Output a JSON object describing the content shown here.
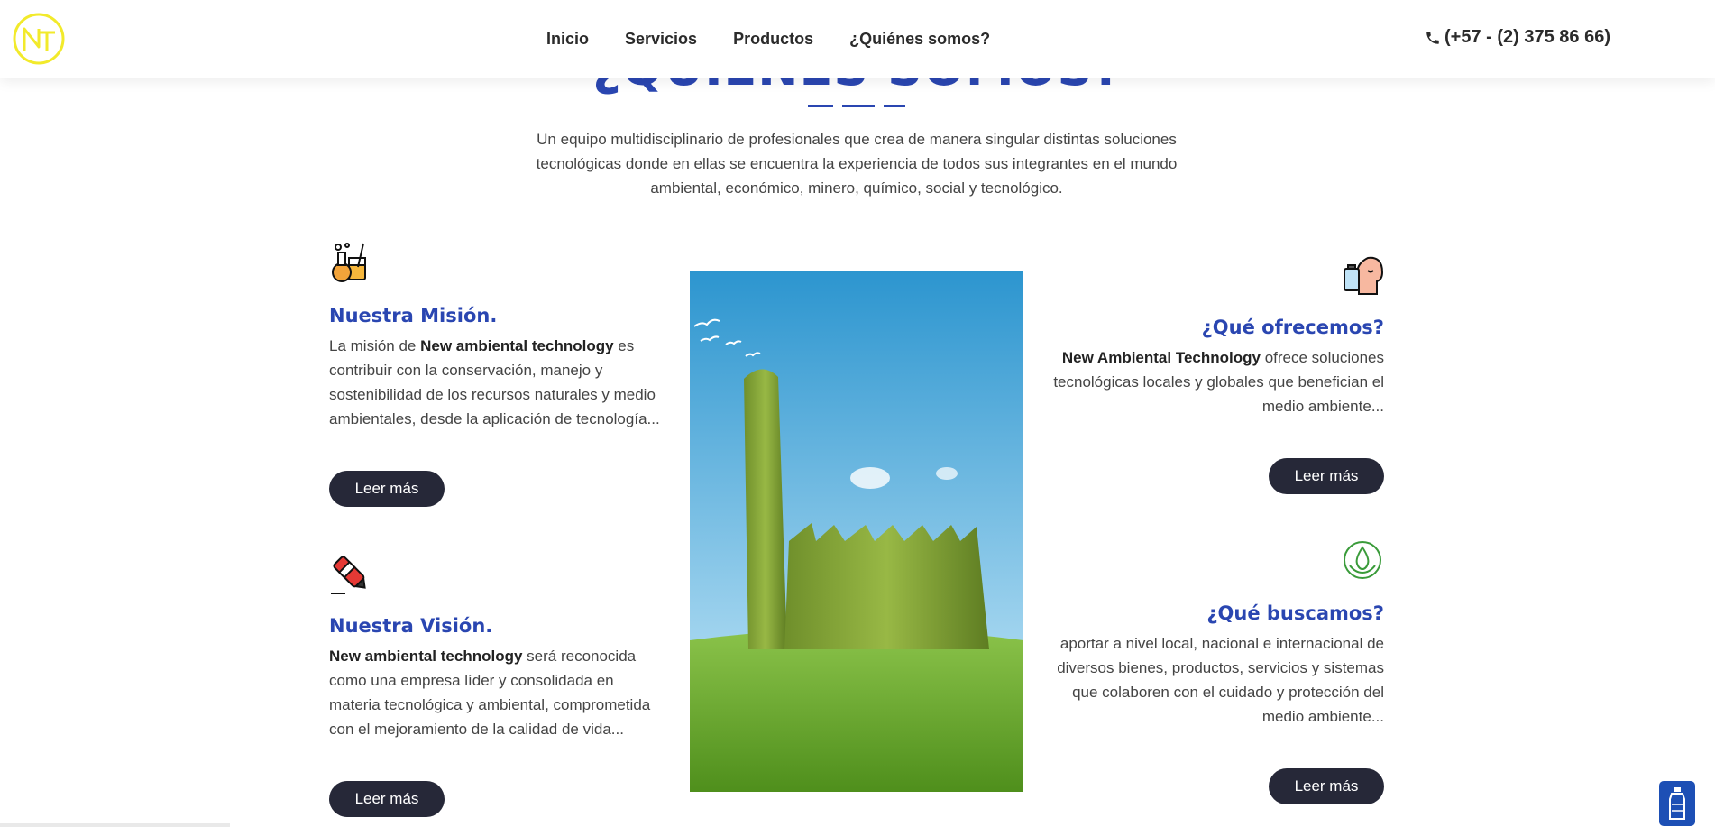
{
  "header": {
    "logo_text": "NT",
    "nav": [
      {
        "label": "Inicio"
      },
      {
        "label": "Servicios"
      },
      {
        "label": "Productos"
      },
      {
        "label": "¿Quiénes somos?"
      }
    ],
    "phone": "(+57 - (2) 375 86 66)",
    "phone_icon": "phone-icon"
  },
  "section": {
    "title": "¿QUIÉNES SOMOS?",
    "intro": "Un equipo multidisciplinario de profesionales que crea de manera singular distintas soluciones tecnológicas donde en ellas se encuentra la experiencia de todos sus integrantes en el mundo ambiental, económico, minero, químico, social y tecnológico."
  },
  "mision": {
    "icon": "chemistry-lab-icon",
    "title": "Nuestra Misión.",
    "bold": "New ambiental technology",
    "text_before": "La misión de ",
    "text_after": " es contribuir con la conservación, manejo y sostenibilidad de los recursos naturales y medio ambientales, desde la aplicación de tecnología...",
    "button": "Leer más"
  },
  "vision": {
    "icon": "marker-pen-icon",
    "title": "Nuestra Visión.",
    "bold": "New ambiental technology",
    "text_after": " será reconocida como una empresa líder y consolidada en materia tecnológica y ambiental, comprometida con el mejoramiento de la calidad de vida...",
    "button": "Leer más"
  },
  "ofrecemos": {
    "icon": "person-drinking-icon",
    "title": "¿Qué ofrecemos?",
    "bold": "New Ambiental Technology",
    "text_after": " ofrece soluciones tecnológicas locales y globales que benefician el medio ambiente...",
    "button": "Leer más"
  },
  "buscamos": {
    "icon": "eco-water-drop-icon",
    "title": "¿Qué buscamos?",
    "text": "aportar a nivel local, nacional e internacional de diversos bienes, productos, servicios y sistemas que colaboren con el cuidado y protección del medio ambiente...",
    "button": "Leer más"
  },
  "widget": {
    "icon": "water-bottle-icon"
  },
  "colors": {
    "accent": "#2a46b1",
    "button": "#262838",
    "logo": "#f2ea2b"
  }
}
